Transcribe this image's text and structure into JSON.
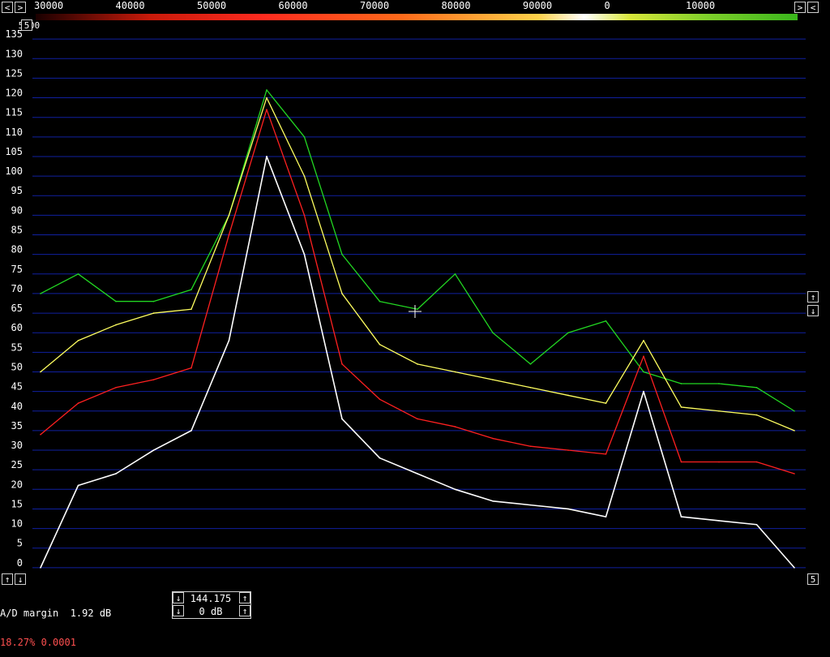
{
  "window": {
    "readout": "5.00",
    "frame_number": "5",
    "ad_margin_label": "A/D margin",
    "ad_margin_value": "1.92 dB",
    "percent_line": "18.27% 0.0001",
    "frequency_value": "144.175",
    "gain_value": "0 dB"
  },
  "icons": {
    "left": "left-arrow-icon",
    "right": "right-arrow-icon",
    "up": "up-arrow-icon",
    "down": "down-arrow-icon"
  },
  "chart_data": {
    "type": "line",
    "title": "",
    "xlabel": "",
    "ylabel": "",
    "x_tick_labels": [
      "30000",
      "40000",
      "50000",
      "60000",
      "70000",
      "80000",
      "90000",
      "0",
      "10000"
    ],
    "y_tick_labels": [
      "135",
      "130",
      "125",
      "120",
      "115",
      "110",
      "105",
      "100",
      "95",
      "90",
      "85",
      "80",
      "75",
      "70",
      "65",
      "60",
      "55",
      "50",
      "45",
      "40",
      "35",
      "30",
      "25",
      "20",
      "15",
      "10",
      "5",
      "0"
    ],
    "ylim": [
      -5,
      140
    ],
    "grid": true,
    "colors": {
      "green": "#22d822",
      "yellow": "#ffff60",
      "red": "#ff2020",
      "white": "#ffffff",
      "grid": "#1020a0"
    },
    "x_index": [
      0,
      5,
      10,
      15,
      20,
      25,
      30,
      35,
      40,
      45,
      50,
      55,
      60,
      65,
      70,
      75,
      80,
      85,
      90,
      95,
      100
    ],
    "series": [
      {
        "color": "green",
        "values": [
          70,
          75,
          68,
          68,
          71,
          90,
          122,
          110,
          80,
          68,
          66,
          75,
          60,
          52,
          60,
          63,
          50,
          47,
          47,
          46,
          40
        ]
      },
      {
        "color": "yellow",
        "values": [
          50,
          58,
          62,
          65,
          66,
          90,
          120,
          100,
          70,
          57,
          52,
          50,
          48,
          46,
          44,
          42,
          58,
          41,
          40,
          39,
          35
        ]
      },
      {
        "color": "red",
        "values": [
          34,
          42,
          46,
          48,
          51,
          85,
          117,
          90,
          52,
          43,
          38,
          36,
          33,
          31,
          30,
          29,
          54,
          27,
          27,
          27,
          24
        ]
      },
      {
        "color": "white",
        "values": [
          0,
          21,
          24,
          30,
          35,
          58,
          105,
          80,
          38,
          28,
          24,
          20,
          17,
          16,
          15,
          13,
          45,
          13,
          12,
          11,
          0
        ]
      }
    ]
  }
}
